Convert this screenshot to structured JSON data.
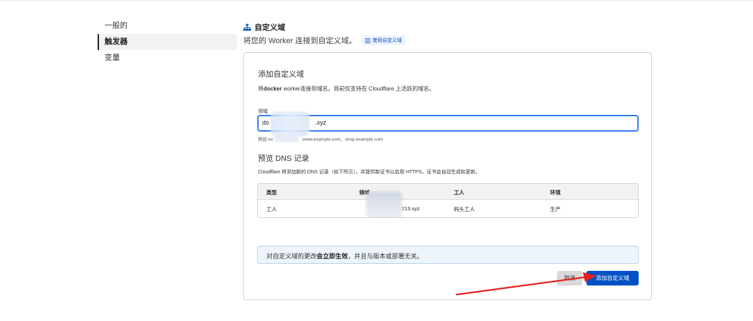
{
  "sidebar": {
    "items": [
      {
        "label": "一般的"
      },
      {
        "label": "触发器"
      },
      {
        "label": "变量"
      }
    ]
  },
  "header": {
    "title": "自定义域",
    "title_icon": "sitemap-icon",
    "description": "将您的 Worker 连接到自定义域。",
    "doc_link": "使用自定义域"
  },
  "card": {
    "title": "添加自定义域",
    "desc_prefix": "将",
    "desc_bold": "docker",
    "desc_suffix": " worker连接到域名。目前仅支持在 Cloudflare 上活跃的域名。",
    "domain_label": "领域",
    "domain_value_start": "do",
    "domain_value_end": ".xyz",
    "example_prefix": "例如 ex",
    "example_suffix": "www.example.com、shop.example.com",
    "dns_title": "预览 DNS 记录",
    "dns_desc": "Cloudflare 将添加新的 DNS 记录（如下所示），并提供新证书以启用 HTTPS。证书会自动生成和更新。",
    "table": {
      "headers": [
        "类型",
        "领域",
        "工人",
        "环境"
      ],
      "rows": [
        [
          "工人",
          "213.xyz",
          "码头工人",
          "生产"
        ]
      ]
    },
    "notice_prefix": "对自定义域的更改",
    "notice_bold": "会立即生效",
    "notice_suffix": "，并且与版本或部署无关。",
    "cancel_label": "取消",
    "add_label": "添加自定义域"
  },
  "colors": {
    "primary": "#0051c3",
    "input_focus": "#2f7bf5",
    "annotation_arrow": "#e8201c"
  }
}
